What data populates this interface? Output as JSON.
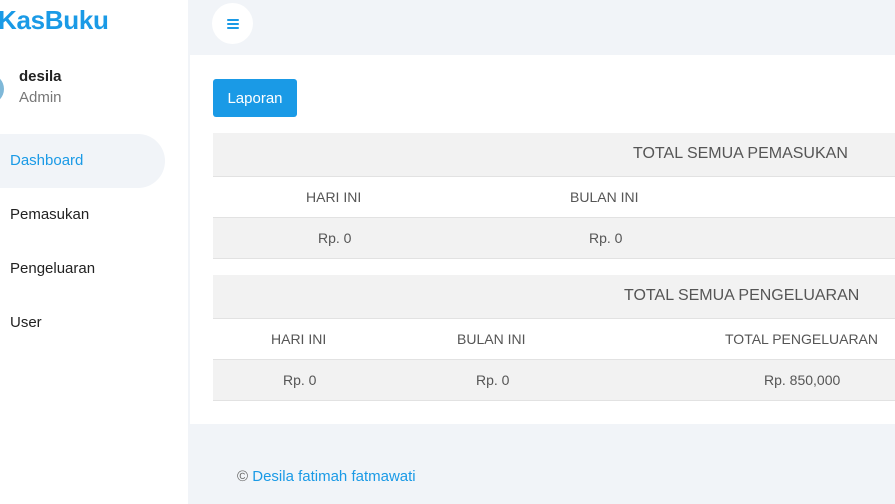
{
  "brand": "KasBuku",
  "user": {
    "name": "desila",
    "role": "Admin"
  },
  "nav": [
    {
      "label": "Dashboard",
      "active": true
    },
    {
      "label": "Pemasukan",
      "active": false
    },
    {
      "label": "Pengeluaran",
      "active": false
    },
    {
      "label": "User",
      "active": false
    }
  ],
  "laporan_button": "Laporan",
  "income": {
    "title": "TOTAL SEMUA PEMASUKAN",
    "col_today": "HARI INI",
    "col_month": "BULAN INI",
    "val_today": "Rp. 0",
    "val_month": "Rp. 0"
  },
  "expense": {
    "title": "TOTAL SEMUA PENGELUARAN",
    "col_today": "HARI INI",
    "col_month": "BULAN INI",
    "col_total": "TOTAL PENGELUARAN",
    "val_today": "Rp. 0",
    "val_month": "Rp. 0",
    "val_total": "Rp. 850,000"
  },
  "footer": {
    "copyright": "©",
    "author": "Desila fatimah fatmawati"
  },
  "colors": {
    "accent": "#1a9ae6",
    "background": "#f1f4f8",
    "table_header": "#f2f2f2"
  }
}
